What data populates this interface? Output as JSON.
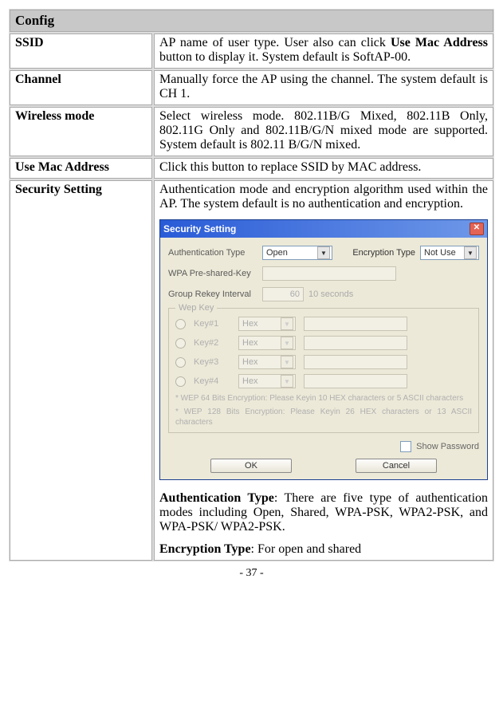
{
  "table": {
    "header": "Config",
    "rows": {
      "ssid": {
        "label": "SSID",
        "desc_pre": "AP name of user type. User also can click ",
        "desc_bold": "Use Mac Address",
        "desc_post": " button to display it. System default is SoftAP-00."
      },
      "channel": {
        "label": "Channel",
        "desc": "Manually force the AP using the channel. The system default is CH 1."
      },
      "wireless": {
        "label": "Wireless mode",
        "desc": "Select wireless mode. 802.11B/G Mixed, 802.11B Only, 802.11G Only and 802.11B/G/N mixed mode are supported. System default is 802.11 B/G/N mixed."
      },
      "usemac": {
        "label": "Use Mac Address",
        "desc": "Click this button to replace SSID by MAC address."
      },
      "security": {
        "label": "Security Setting",
        "desc": "Authentication mode and encryption algorithm used within the AP. The system default is no authentication and encryption.",
        "auth_heading": "Authentication Type",
        "auth_text": ": There are five type of authentication modes including Open, Shared, WPA-PSK, WPA2-PSK, and WPA-PSK/ WPA2-PSK.",
        "enc_heading": "Encryption Type",
        "enc_text": ": For open and shared"
      }
    }
  },
  "dialog": {
    "title": "Security Setting",
    "close_glyph": "✕",
    "auth_label": "Authentication Type",
    "auth_value": "Open",
    "enc_label": "Encryption Type",
    "enc_value": "Not Use",
    "wpa_label": "WPA Pre-shared-Key",
    "group_label": "Group Rekey Interval",
    "group_value": "60",
    "group_unit": "10 seconds",
    "wep_legend": "Wep Key",
    "hex": "Hex",
    "keys": [
      "Key#1",
      "Key#2",
      "Key#3",
      "Key#4"
    ],
    "hint1": "* WEP 64 Bits Encryption:  Please Keyin 10 HEX characters or 5 ASCII characters",
    "hint2": "* WEP 128 Bits Encryption:  Please Keyin 26 HEX characters or 13 ASCII characters",
    "show_pw": "Show Password",
    "ok": "OK",
    "cancel": "Cancel"
  },
  "page_number": "- 37 -"
}
